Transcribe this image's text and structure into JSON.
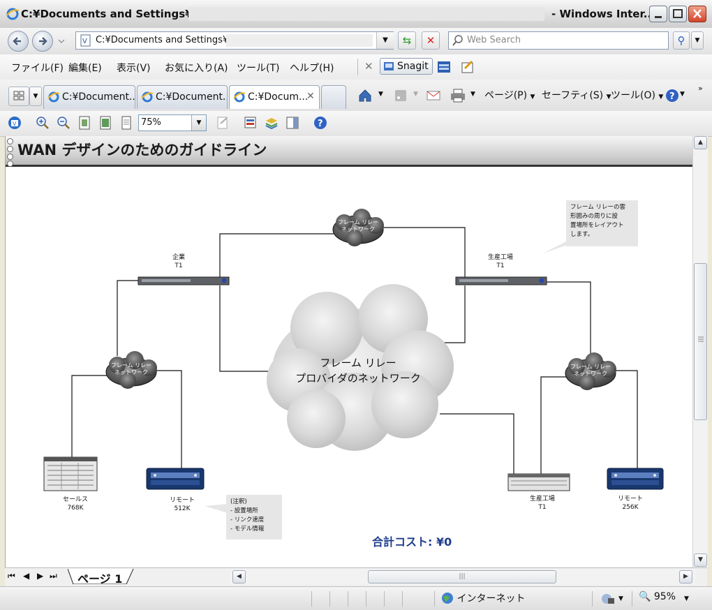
{
  "window": {
    "title": "C:¥Documents and Settings¥",
    "title_suffix": "- Windows Inter..."
  },
  "address_bar": {
    "url": "C:¥Documents and Settings¥",
    "search_placeholder": "Web Search"
  },
  "menu": {
    "items": [
      "ファイル(F)",
      "編集(E)",
      "表示(V)",
      "お気に入り(A)",
      "ツール(T)",
      "ヘルプ(H)"
    ],
    "snagit_label": "Snagit"
  },
  "tabs": [
    {
      "label": "C:¥Document..."
    },
    {
      "label": "C:¥Document..."
    },
    {
      "label": "C:¥Docum..."
    }
  ],
  "command_bar": {
    "page": "ページ(P)",
    "safety": "セーフティ(S)",
    "tools": "ツール(O)"
  },
  "viewer_toolbar": {
    "zoom_value": "75%"
  },
  "document": {
    "title": "WAN デザインのためのガイドライン",
    "cloud_main_label": [
      "フレーム リレー",
      "プロバイダのネットワーク"
    ],
    "cloud_small_label": [
      "フレーム リレー",
      "ネットワーク"
    ],
    "nodes": {
      "corporate": [
        "企業",
        "T1"
      ],
      "plant_top": [
        "生産工場",
        "T1"
      ],
      "sales": [
        "セールス",
        "768K"
      ],
      "remote_left": [
        "リモート",
        "512K"
      ],
      "plant_bottom": [
        "生産工場",
        "T1"
      ],
      "remote_right": [
        "リモート",
        "256K"
      ]
    },
    "note_layout": [
      "フレーム リレーの雲",
      "形囲みの周りに設",
      "置場所をレイアウト",
      "します。"
    ],
    "note_legend": [
      "(注釈)",
      "- 設置場所",
      "- リンク速度",
      "- モデル情報"
    ],
    "total_cost": "合計コスト: ¥0"
  },
  "page_tabs": {
    "current": "ページ 1"
  },
  "status_bar": {
    "zone": "インターネット",
    "zoom": "95%"
  }
}
